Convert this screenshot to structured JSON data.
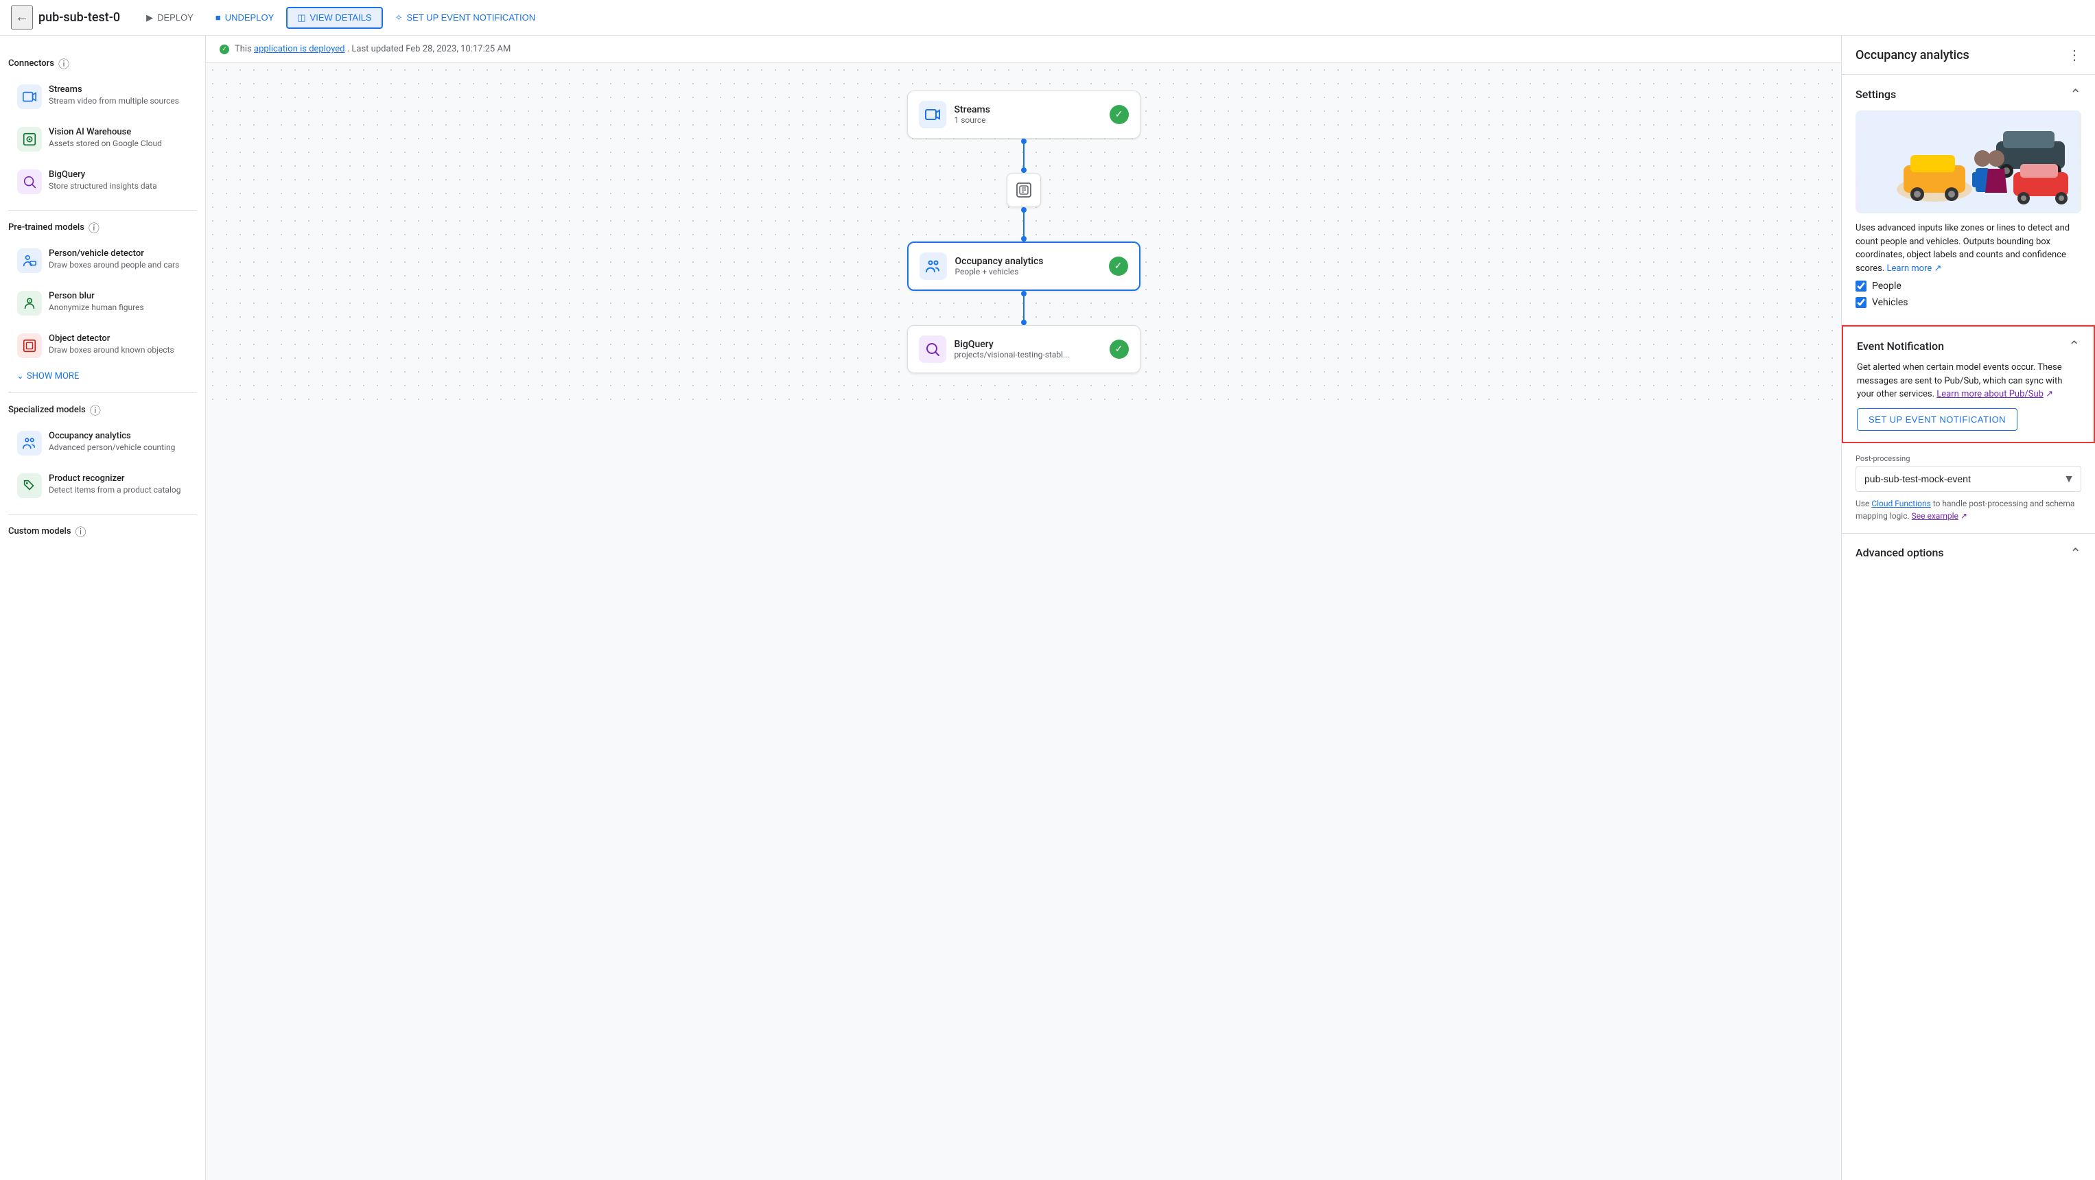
{
  "topbar": {
    "back_label": "←",
    "app_title": "pub-sub-test-0",
    "deploy_label": "DEPLOY",
    "undeploy_label": "UNDEPLOY",
    "view_details_label": "VIEW DETAILS",
    "setup_event_label": "SET UP EVENT NOTIFICATION"
  },
  "status_bar": {
    "text": "This",
    "link_text": "application is deployed",
    "suffix": ". Last updated Feb 28, 2023, 10:17:25 AM"
  },
  "sidebar": {
    "connectors_title": "Connectors",
    "connectors": [
      {
        "title": "Streams",
        "desc": "Stream video from multiple sources",
        "icon": "📹"
      },
      {
        "title": "Vision AI Warehouse",
        "desc": "Assets stored on Google Cloud",
        "icon": "🏛"
      },
      {
        "title": "BigQuery",
        "desc": "Store structured insights data",
        "icon": "🔍"
      }
    ],
    "pretrained_title": "Pre-trained models",
    "pretrained": [
      {
        "title": "Person/vehicle detector",
        "desc": "Draw boxes around people and cars",
        "icon": "👤"
      },
      {
        "title": "Person blur",
        "desc": "Anonymize human figures",
        "icon": "😶"
      },
      {
        "title": "Object detector",
        "desc": "Draw boxes around known objects",
        "icon": "📦"
      }
    ],
    "show_more_label": "SHOW MORE",
    "specialized_title": "Specialized models",
    "specialized": [
      {
        "title": "Occupancy analytics",
        "desc": "Advanced person/vehicle counting",
        "icon": "👥"
      },
      {
        "title": "Product recognizer",
        "desc": "Detect items from a product catalog",
        "icon": "👕"
      }
    ],
    "custom_title": "Custom models"
  },
  "canvas": {
    "nodes": [
      {
        "id": "streams",
        "title": "Streams",
        "sub": "1 source",
        "icon": "📹",
        "checked": true
      },
      {
        "id": "occupancy",
        "title": "Occupancy analytics",
        "sub": "People + vehicles",
        "icon": "👥",
        "checked": true,
        "selected": true
      },
      {
        "id": "bigquery",
        "title": "BigQuery",
        "sub": "projects/visionai-testing-stabl...",
        "icon": "📊",
        "checked": true
      }
    ]
  },
  "right_panel": {
    "title": "Occupancy analytics",
    "settings_title": "Settings",
    "settings_desc": "Uses advanced inputs like zones or lines to detect and count people and vehicles. Outputs bounding box coordinates, object labels and counts and confidence scores.",
    "learn_more_label": "Learn more",
    "people_label": "People",
    "vehicles_label": "Vehicles",
    "people_checked": true,
    "vehicles_checked": true,
    "event_notif_title": "Event Notification",
    "event_desc": "Get alerted when certain model events occur. These messages are sent to Pub/Sub, which can sync with your other services.",
    "pubsub_link_label": "Learn more about Pub/Sub",
    "setup_btn_label": "SET UP EVENT NOTIFICATION",
    "post_processing_label": "Post-processing",
    "post_processing_value": "pub-sub-test-mock-event",
    "post_desc_text": "Use",
    "cloud_functions_label": "Cloud Functions",
    "post_desc_suffix": "to handle post-processing and schema mapping logic.",
    "see_example_label": "See example",
    "advanced_title": "Advanced options"
  }
}
